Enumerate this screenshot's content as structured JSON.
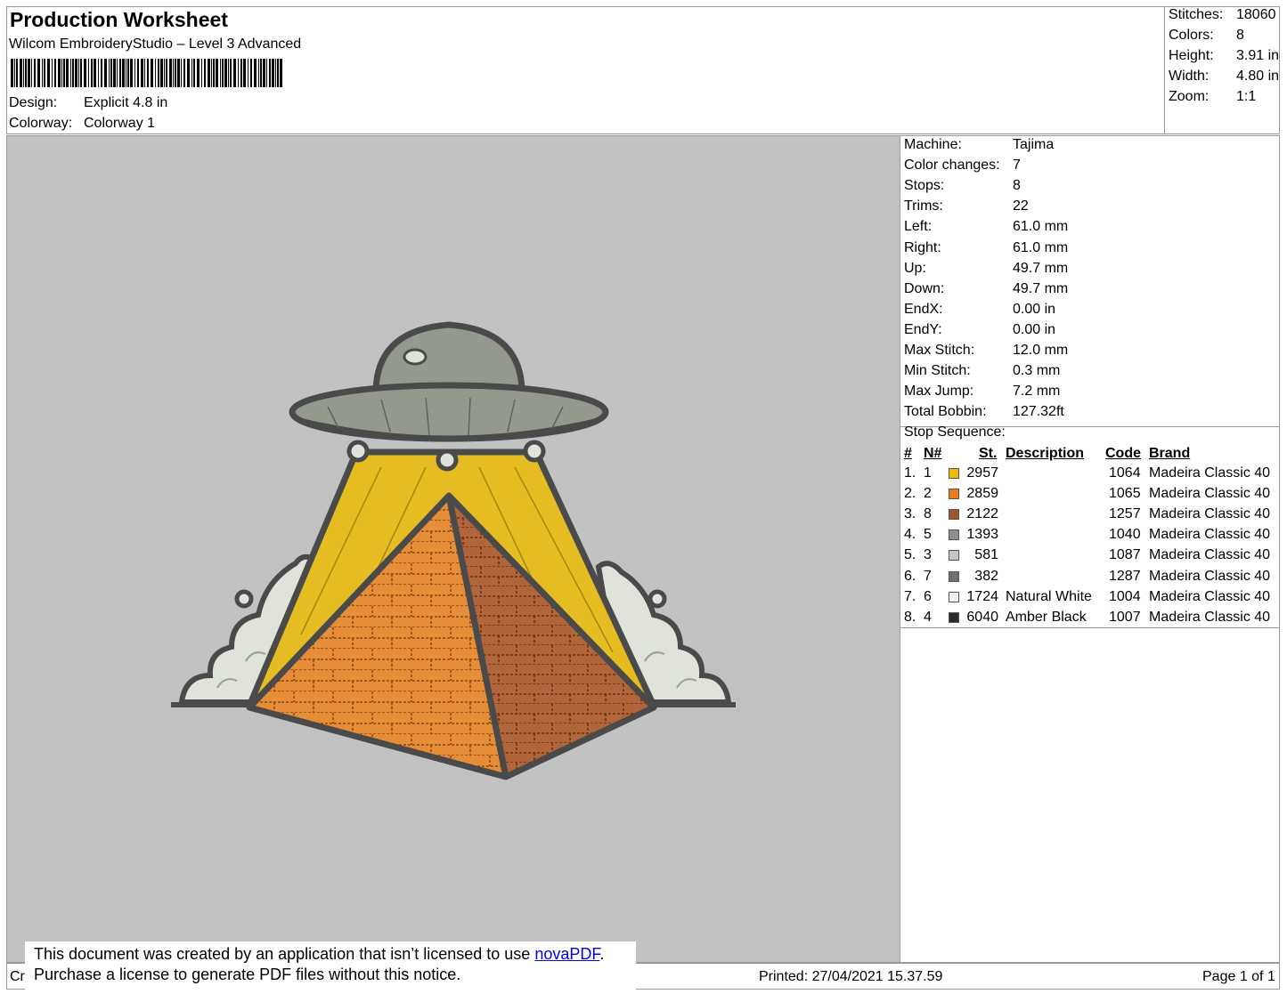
{
  "header": {
    "title": "Production Worksheet",
    "software": "Wilcom EmbroideryStudio – Level 3 Advanced",
    "design_label": "Design:",
    "design_value": "Explicit 4.8 in",
    "colorway_label": "Colorway:",
    "colorway_value": "Colorway 1"
  },
  "stats": [
    {
      "label": "Stitches:",
      "value": "18060"
    },
    {
      "label": "Colors:",
      "value": "8"
    },
    {
      "label": "Height:",
      "value": "3.91 in"
    },
    {
      "label": "Width:",
      "value": "4.80 in"
    },
    {
      "label": "Zoom:",
      "value": "1:1"
    }
  ],
  "properties": [
    {
      "label": "Machine:",
      "value": "Tajima"
    },
    {
      "label": "Color changes:",
      "value": "7"
    },
    {
      "label": "Stops:",
      "value": "8"
    },
    {
      "label": "Trims:",
      "value": "22"
    },
    {
      "label": "Left:",
      "value": "61.0 mm"
    },
    {
      "label": "Right:",
      "value": "61.0 mm"
    },
    {
      "label": "Up:",
      "value": "49.7 mm"
    },
    {
      "label": "Down:",
      "value": "49.7 mm"
    },
    {
      "label": "EndX:",
      "value": "0.00 in"
    },
    {
      "label": "EndY:",
      "value": "0.00 in"
    },
    {
      "label": "Max Stitch:",
      "value": "12.0 mm"
    },
    {
      "label": "Min Stitch:",
      "value": "0.3 mm"
    },
    {
      "label": "Max Jump:",
      "value": "7.2 mm"
    },
    {
      "label": "Total Bobbin:",
      "value": "127.32ft"
    }
  ],
  "stop_sequence": {
    "title": "Stop Sequence:",
    "headers": {
      "num": "#",
      "n": "N#",
      "st": "St.",
      "description": "Description",
      "code": "Code",
      "brand": "Brand"
    },
    "rows": [
      {
        "num": "1.",
        "n": "1",
        "color": "#f5b800",
        "st": "2957",
        "description": "",
        "code": "1064",
        "brand": "Madeira Classic 40"
      },
      {
        "num": "2.",
        "n": "2",
        "color": "#ec7b1c",
        "st": "2859",
        "description": "",
        "code": "1065",
        "brand": "Madeira Classic 40"
      },
      {
        "num": "3.",
        "n": "8",
        "color": "#a3522b",
        "st": "2122",
        "description": "",
        "code": "1257",
        "brand": "Madeira Classic 40"
      },
      {
        "num": "4.",
        "n": "5",
        "color": "#8e8e8e",
        "st": "1393",
        "description": "",
        "code": "1040",
        "brand": "Madeira Classic 40"
      },
      {
        "num": "5.",
        "n": "3",
        "color": "#c6c6c6",
        "st": "581",
        "description": "",
        "code": "1087",
        "brand": "Madeira Classic 40"
      },
      {
        "num": "6.",
        "n": "7",
        "color": "#707070",
        "st": "382",
        "description": "",
        "code": "1287",
        "brand": "Madeira Classic 40"
      },
      {
        "num": "7.",
        "n": "6",
        "color": "#efeff4",
        "st": "1724",
        "description": "Natural White",
        "code": "1004",
        "brand": "Madeira Classic 40"
      },
      {
        "num": "8.",
        "n": "4",
        "color": "#2a2a2a",
        "st": "6040",
        "description": "Amber Black",
        "code": "1007",
        "brand": "Madeira Classic 40"
      }
    ]
  },
  "footer": {
    "left_text": "Cr",
    "printed": "Printed: 27/04/2021 15.37.59",
    "page": "Page 1 of 1"
  },
  "notice": {
    "line1_prefix": "This document was created by an application that isn’t licensed to use ",
    "line1_link": "novaPDF",
    "line1_suffix": ".",
    "line2": "Purchase a license to generate PDF files without this notice."
  },
  "colors": {
    "canvas_bg": "#c2c2c2",
    "beam": "#e5bd22",
    "pyramid_left": "#e58d37",
    "pyramid_right": "#b0663a",
    "ufo": "#939a8d",
    "clouds": "#dfe3d9",
    "outline": "#4a4a4a"
  }
}
